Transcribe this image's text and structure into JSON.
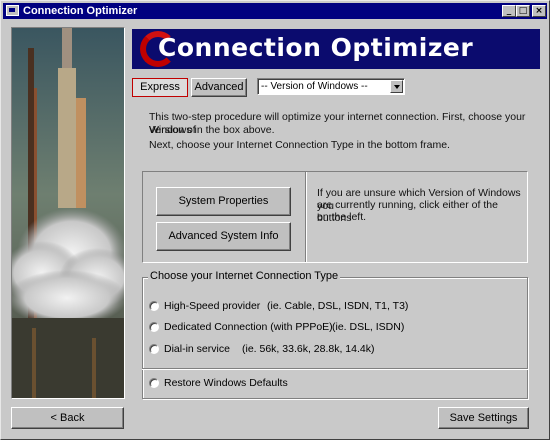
{
  "window": {
    "title": "Connection Optimizer",
    "minimize": "_",
    "maximize": "□",
    "close": "×"
  },
  "banner": {
    "text": "Connection Optimizer"
  },
  "toolbar": {
    "express_label": "Express",
    "advanced_label": "Advanced",
    "version_select_value": "-- Version of Windows --"
  },
  "instructions": {
    "line1": "This two-step procedure will optimize your internet connection.  First, choose your Version of",
    "line2": "Windows in the box above.",
    "line3": "Next, choose your Internet Connection Type in the bottom frame."
  },
  "system_panel": {
    "system_properties_label": "System Properties",
    "advanced_info_label": "Advanced System Info",
    "hint_line1": "If you are unsure which Version of Windows you",
    "hint_line2": "are currently running, click either of the buttons",
    "hint_line3": "on the left."
  },
  "connection_group": {
    "title": "Choose your Internet Connection Type",
    "options": [
      {
        "label": "High-Speed provider",
        "hint": "(ie. Cable, DSL, ISDN, T1, T3)"
      },
      {
        "label": "Dedicated Connection (with PPPoE)",
        "hint": "(ie. DSL, ISDN)"
      },
      {
        "label": "Dial-in service",
        "hint": "(ie. 56k, 33.6k, 28.8k, 14.4k)"
      }
    ],
    "restore_label": "Restore Windows Defaults"
  },
  "footer": {
    "back_label": "< Back",
    "save_label": "Save Settings"
  },
  "colors": {
    "titlebar": "#000080",
    "banner": "#0b0b6e",
    "swoosh": "#c00000",
    "face": "#c9c9c9"
  }
}
